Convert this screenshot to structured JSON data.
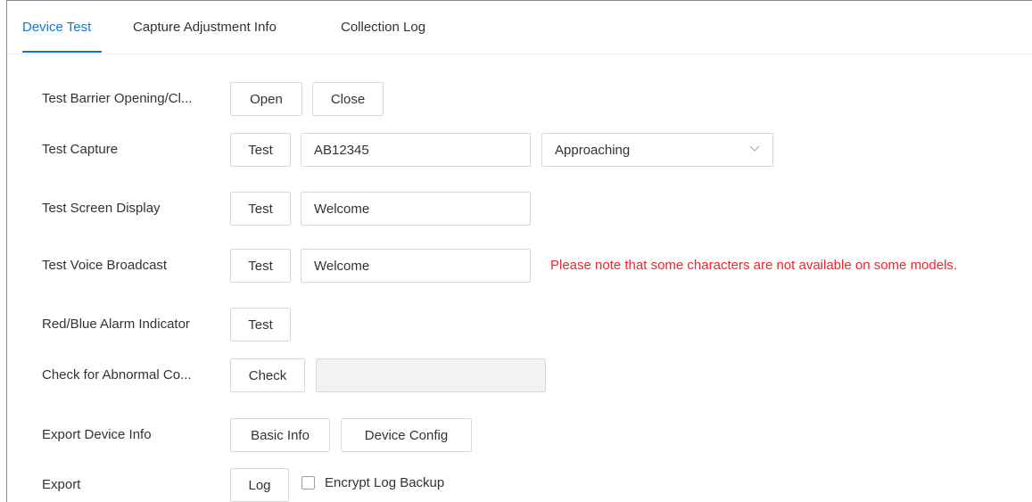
{
  "tabs": [
    {
      "label": "Device Test",
      "active": true
    },
    {
      "label": "Capture Adjustment Info",
      "active": false
    },
    {
      "label": "Collection Log",
      "active": false
    }
  ],
  "rows": {
    "barrier": {
      "label": "Test Barrier Opening/Cl...",
      "open_label": "Open",
      "close_label": "Close"
    },
    "capture": {
      "label": "Test Capture",
      "test_label": "Test",
      "plate_value": "AB12345",
      "direction_value": "Approaching"
    },
    "screen": {
      "label": "Test Screen Display",
      "test_label": "Test",
      "text_value": "Welcome"
    },
    "voice": {
      "label": "Test Voice Broadcast",
      "test_label": "Test",
      "text_value": "Welcome",
      "note": "Please note that some characters are not available on some models."
    },
    "alarm": {
      "label": "Red/Blue Alarm Indicator",
      "test_label": "Test"
    },
    "abnormal": {
      "label": "Check for Abnormal Co...",
      "check_label": "Check",
      "result_value": ""
    },
    "export_info": {
      "label": "Export Device Info",
      "basic_label": "Basic Info",
      "config_label": "Device Config"
    },
    "export": {
      "label": "Export",
      "log_label": "Log",
      "encrypt_label": "Encrypt Log Backup",
      "encrypt_checked": false
    }
  },
  "colors": {
    "accent": "#1677d2",
    "warning": "#f5222d"
  },
  "icons": {
    "select": "chevron-down-icon"
  }
}
